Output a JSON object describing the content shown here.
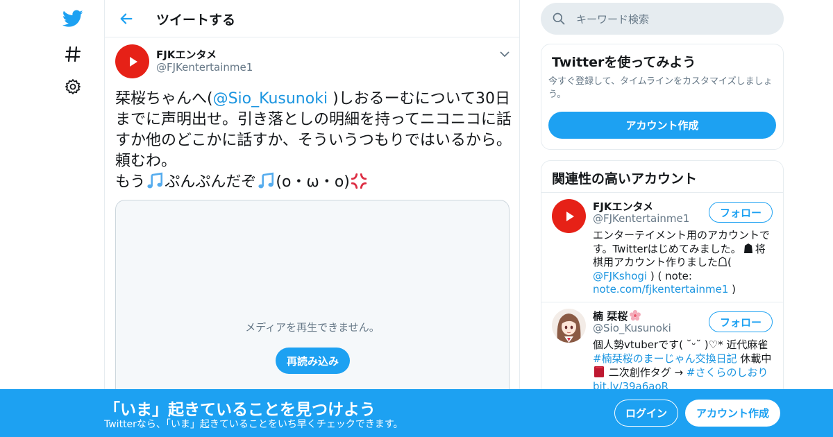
{
  "header": {
    "title": "ツイートする"
  },
  "tweet": {
    "author_name": "FJKエンタメ",
    "author_handle": "@FJKentertainme1",
    "text_part1": "栞桜ちゃんへ(",
    "mention": "@Sio_Kusunoki",
    "text_part2": " )しおるーむについて30日までに声明出せ。引き落としの明細を持ってニコニコに話すか他のどこかに話すか、そういうつもりではいるから。頼むわ。",
    "text_part3": "もう",
    "text_part4": "ぷんぷんだぞ",
    "text_part5": "(o・ω・o)",
    "media_message": "メディアを再生できません。",
    "reload_label": "再読み込み"
  },
  "search": {
    "placeholder": "キーワード検索"
  },
  "signup_card": {
    "title": "Twitterを使ってみよう",
    "description": "今すぐ登録して、タイムラインをカスタマイズしましょう。",
    "button": "アカウント作成"
  },
  "related": {
    "title": "関連性の高いアカウント",
    "accounts": [
      {
        "name": "FJKエンタメ",
        "handle": "@FJKentertainme1",
        "follow": "フォロー",
        "bio1": "エンターテイメント用のアカウントです。Twitterはじめてみました。",
        "bio2": "将棋用アカウント作りました",
        "bio3": "(",
        "bio_link1": "@FJKshogi",
        "bio4": " ) ( note: ",
        "bio_link2": "note.com/fjkentertainme1",
        "bio5": " )"
      },
      {
        "name": "楠 栞桜",
        "handle": "@Sio_Kusunoki",
        "follow": "フォロー",
        "bio1": "個人勢vtuberです( ˘ᵕ˘ )♡* 近代麻雀 ",
        "bio_link1": "#楠栞桜のまーじゃん交換日記",
        "bio2": " 休載中 ",
        "bio3": " 二次創作タグ → ",
        "bio_link2": "#さくらのしおり",
        "bio_link3": "bit.ly/39a6aoR"
      }
    ]
  },
  "banner": {
    "title": "「いま」起きていることを見つけよう",
    "subtitle": "Twitterなら、「いま」起きていることをいち早くチェックできます。",
    "login": "ログイン",
    "signup": "アカウント作成"
  },
  "colors": {
    "accent": "#1da1f2",
    "youtube_red": "#e62117"
  }
}
